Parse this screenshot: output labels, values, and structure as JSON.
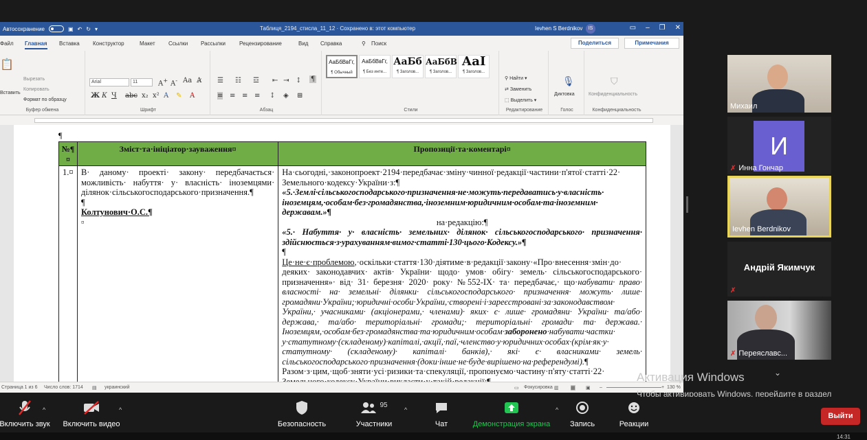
{
  "word": {
    "autosave_label": "Автосохранение",
    "doc_title": "Таблиця_2194_стисла_11_12 · Сохранено в: этот компьютер",
    "user_name": "Ievhen S Berdnikov",
    "user_initials": "IS",
    "menu": [
      "Файл",
      "Главная",
      "Вставка",
      "Конструктор",
      "Макет",
      "Ссылки",
      "Рассылки",
      "Рецензирование",
      "Вид",
      "Справка"
    ],
    "search_label": "Поиск",
    "share_label": "Поделиться",
    "comments_label": "Примечания",
    "ribbon": {
      "paste": "Вставить",
      "cut": "Вырезать",
      "copy": "Копировать",
      "format_painter": "Формат по образцу",
      "clipboard_group": "Буфер обмена",
      "font_name": "Arial",
      "font_size": "11",
      "font_group": "Шрифт",
      "paragraph_group": "Абзац",
      "styles": [
        {
          "preview": "АаБбВвГг,",
          "name": "¶ Обычный"
        },
        {
          "preview": "АаБбВвГг,",
          "name": "¶ Без инте..."
        },
        {
          "preview": "АаБб",
          "name": "¶ Заголов..."
        },
        {
          "preview": "АаБбВ",
          "name": "¶ Заголов..."
        },
        {
          "preview": "АаI",
          "name": "¶ Заголов..."
        }
      ],
      "styles_group": "Стили",
      "find": "Найти",
      "replace": "Заменить",
      "select": "Выделить",
      "editing_group": "Редактирование",
      "dictate": "Диктовка",
      "voice_group": "Голос",
      "sensitivity": "Конфиденциальность",
      "sensitivity_group": "Конфиденциальность"
    },
    "table": {
      "headers": [
        "№¶ ¤",
        "Зміст·та·ініціатор·зауваження¤",
        "Пропозиції·та·коментарі¤"
      ],
      "row_num": "1.¤",
      "left_text": "В· даному· проекті· закону· передбачається· можливість· набуття· у· власність· іноземцями· ділянок·сільськогосподарського·призначення.¶",
      "left_pilcrow": "¶",
      "left_author": "Колтунович·О.С.¶",
      "left_end": "¤",
      "r1": "На·сьогодні,·законопроект·2194·передбачає·зміну·чинної·редакції·частини·п'ятої·статті·22· Земельного·кодексу·України·з:¶",
      "r2": "«5.·Землі·сільськогосподарського·призначення·не·можуть·передаватись·у·власність· іноземцям,·особам·без·громадянства,·іноземним·юридичним·особам·та·іноземним· державам.»¶",
      "r3": "на·редакцію:¶",
      "r4": "«5.· Набуття· у· власність· земельних· ділянок· сільськогосподарського· призначення· здійснюється·з·урахуванням·вимог·статті·130·цього·Кодексу.»¶",
      "r5": "¶",
      "r6_ul": "Це·не·є·проблемою",
      "r6": ",·оскільки·стаття·130·діятиме·в·редакції·закону·«Про·внесення·змін·до· деяких· законодавчих· актів· України· щодо· умов· обігу· земель· сільськогосподарського· призначення»· від· 31· березня· 2020· року· №552-IX· та· передбачає,· що·",
      "r6_it": "набувати· право· власності· на· земельні· ділянки· сільськогосподарського· призначення· можуть· лише· громадяни·України;·юридичні·особи·України,·створені·і·зареєстровані·за·законодавством· України,· учасниками· (акціонерами,· членами)· яких· є· лише· громадяни· України· та/або· держава,· та/або· територіальні· громади;· територіальні· громади· та· держава.· Іноземцям,·особам·без·громадянства·та·юридичним·особам·",
      "r6_bi": "заборонено",
      "r6_it2": "·набувати·частки· у·статутному·(складеному)·капіталі,·акції,·паї,·членство·у·юридичних·особах·(крім·як·у· статутному· (складеному)· капіталі· банків),· які· є· власниками· земель· сільськогосподарського·призначення·(доки·інше·не·буде·вирішено·на·референдумі).",
      "r6_end": "¶",
      "r7": "Разом·з·цим,·щоб·зняти·усі·ризики·та·спекуляції,·пропонуємо·частину·п'яту·статті·22· Земельного·кодексу·України·викласти·у·такій·редакції:¶"
    },
    "doc_pilcrow": "¶",
    "status": {
      "page": "Страница 1 из 6",
      "words": "Число слов: 1714",
      "lang": "украинский",
      "focus": "Фокусировка",
      "zoom": "130 %"
    }
  },
  "participants": [
    {
      "name": "Михаил",
      "muted": false
    },
    {
      "name": "Инна Гончар",
      "muted": true,
      "initial": "И"
    },
    {
      "name": "Ievhen Berdnikov",
      "muted": false
    },
    {
      "name": "Андрій Якимчук",
      "muted": true
    },
    {
      "name": "Переяславс...",
      "muted": true
    }
  ],
  "activation": {
    "title": "Активация Windows",
    "subtitle": "Чтобы активировать Windows, перейдите в раздел \"Параметры\"."
  },
  "toolbar": {
    "mute": "Включить звук",
    "video": "Включить видео",
    "security": "Безопасность",
    "participants": "Участники",
    "participants_count": "95",
    "chat": "Чат",
    "share": "Демонстрация экрана",
    "record": "Запись",
    "reactions": "Реакции",
    "leave": "Выйти"
  },
  "clock": "14:31",
  "colors": {
    "word_blue": "#2b579a",
    "table_header": "#70ad47",
    "share_green": "#23c552",
    "leave_red": "#c52626",
    "active_speaker": "#e8d55a"
  }
}
